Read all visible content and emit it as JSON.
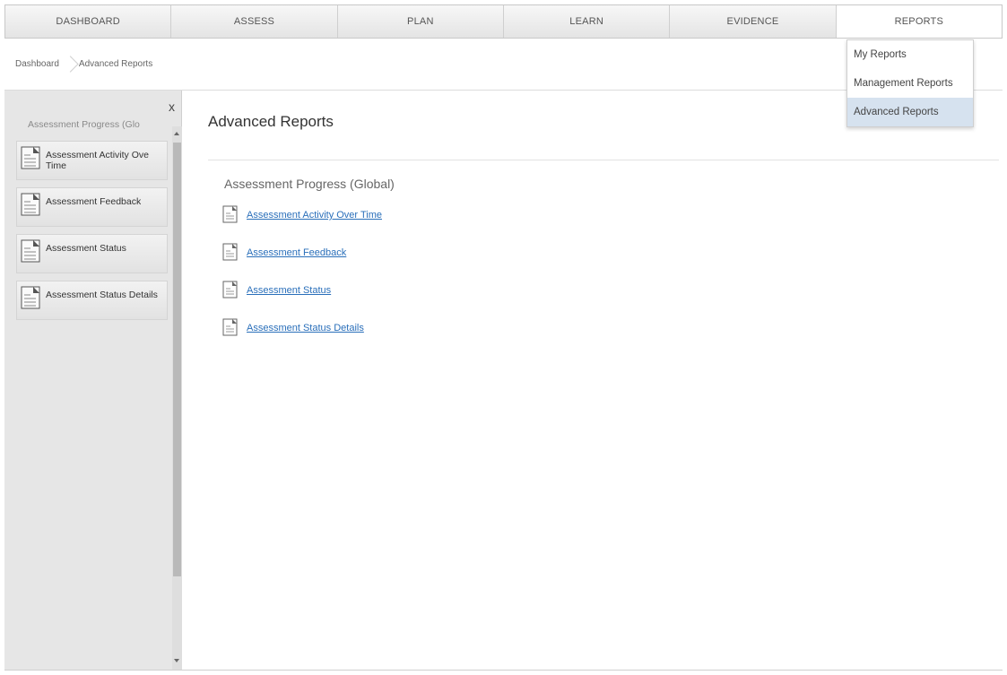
{
  "nav": {
    "tabs": [
      {
        "label": "DASHBOARD"
      },
      {
        "label": "ASSESS"
      },
      {
        "label": "PLAN"
      },
      {
        "label": "LEARN"
      },
      {
        "label": "EVIDENCE"
      },
      {
        "label": "REPORTS",
        "active": true
      }
    ]
  },
  "breadcrumb": {
    "items": [
      "Dashboard",
      "Advanced Reports"
    ]
  },
  "reports_menu": {
    "items": [
      "My Reports",
      "Management Reports",
      "Advanced Reports"
    ],
    "selected": "Advanced Reports"
  },
  "sidebar": {
    "close_label": "x",
    "group_title": "Assessment Progress (Glo",
    "items": [
      {
        "label": "Assessment Activity Ove Time"
      },
      {
        "label": "Assessment Feedback"
      },
      {
        "label": "Assessment Status"
      },
      {
        "label": "Assessment Status Details"
      }
    ]
  },
  "main": {
    "title": "Advanced Reports",
    "section_title": "Assessment Progress (Global)",
    "links": [
      {
        "label": "Assessment Activity Over Time"
      },
      {
        "label": "Assessment Feedback"
      },
      {
        "label": "Assessment Status"
      },
      {
        "label": "Assessment Status Details"
      }
    ]
  },
  "colors": {
    "link": "#2a6fba",
    "selected_menu_bg": "#d6e2ef",
    "sidebar_bg": "#e6e6e6"
  },
  "icons": {
    "report": "document-icon"
  }
}
